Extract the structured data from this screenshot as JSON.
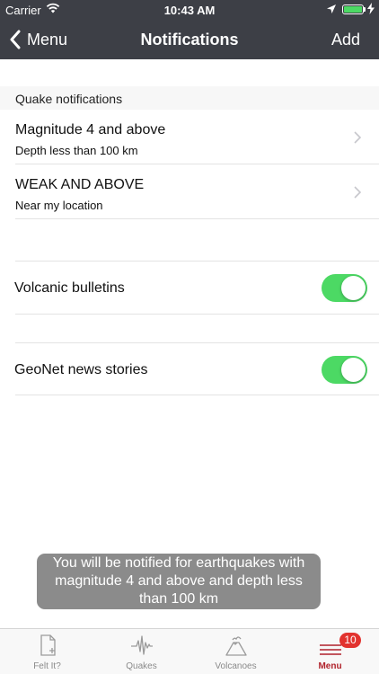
{
  "status_bar": {
    "carrier": "Carrier",
    "time": "10:43 AM",
    "battery_level": 1.0,
    "battery_color": "#4cd964"
  },
  "nav": {
    "back_label": "Menu",
    "title": "Notifications",
    "add_label": "Add",
    "background": "#3d3f46"
  },
  "quake_section": {
    "header": "Quake notifications",
    "items": [
      {
        "title": "Magnitude 4 and above",
        "subtitle": "Depth less than 100 km"
      },
      {
        "title": "WEAK AND ABOVE",
        "subtitle": "Near my location"
      }
    ]
  },
  "toggles": [
    {
      "label": "Volcanic bulletins",
      "on": true
    },
    {
      "label": "GeoNet news stories",
      "on": true
    }
  ],
  "toast": {
    "message": "You will be notified for earthquakes with magnitude 4 and above and depth less than 100 km"
  },
  "tabbar": {
    "tabs": [
      {
        "label": "Felt It?",
        "icon": "felt-it-document-icon",
        "active": false
      },
      {
        "label": "Quakes",
        "icon": "seismograph-icon",
        "active": false
      },
      {
        "label": "Volcanoes",
        "icon": "volcano-icon",
        "active": false
      },
      {
        "label": "Menu",
        "icon": "menu-icon",
        "active": true
      }
    ],
    "menu_badge": "10",
    "active_color": "#b0212a"
  }
}
